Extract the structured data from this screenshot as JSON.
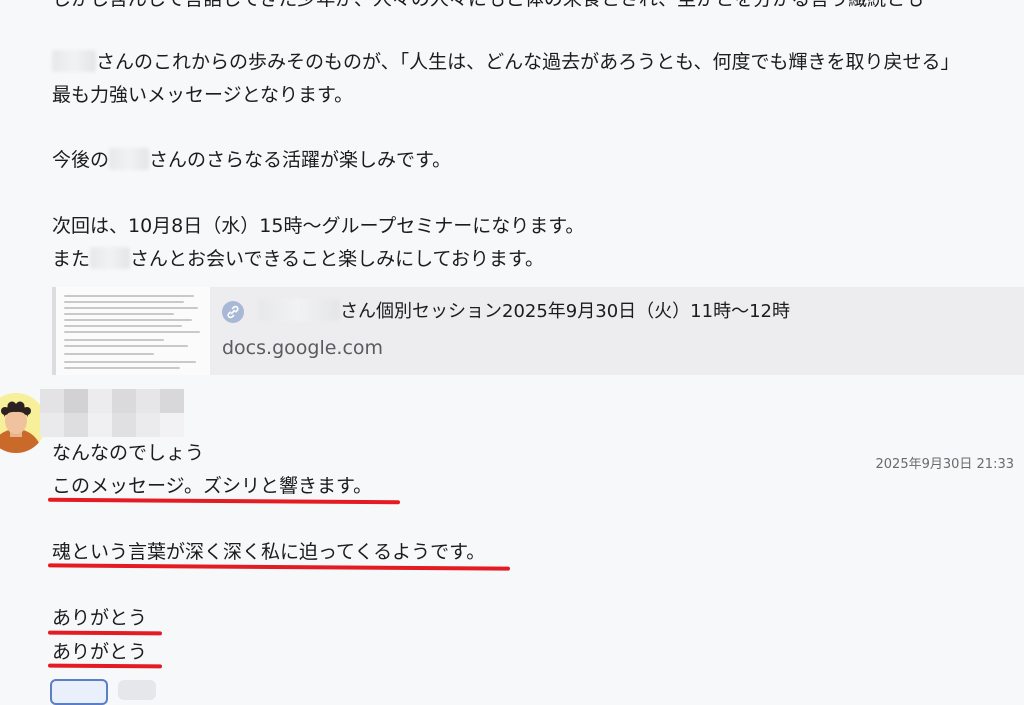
{
  "message1": {
    "top_partial": "しかし含んして言語してきた少年が、人々の人々にもこ体の来食とされ、至かとを分かる言う繊続とも",
    "p1_name_blur": "",
    "p1_text": "さんのこれからの歩みそのものが、「人生は、どんな過去があろうとも、何度でも輝きを取り戻せる」",
    "p1_line2": "最も力強いメッセージとなります。",
    "p2_a": "今後の",
    "p2_b": "さんのさらなる活躍が楽しみです。",
    "p3_line1": "次回は、10月8日（水）15時〜グループセミナーになります。",
    "p3_a": "また",
    "p3_b": "さんとお会いできること楽しみにしております。"
  },
  "link_card": {
    "icon": "link-icon",
    "title_suffix": "さん個別セッション2025年9月30日（火）11時〜12時",
    "domain": "docs.google.com"
  },
  "message2": {
    "avatar": "user-avatar",
    "timestamp": "2025年9月30日 21:33",
    "line1": "なんなのでしょう",
    "line2": "このメッセージ。ズシリと響きます。",
    "line3": "魂という言葉が深く深く私に迫ってくるようです。",
    "line4": "ありがとう",
    "line5": "ありがとう",
    "underline_color": "#e41b23"
  }
}
